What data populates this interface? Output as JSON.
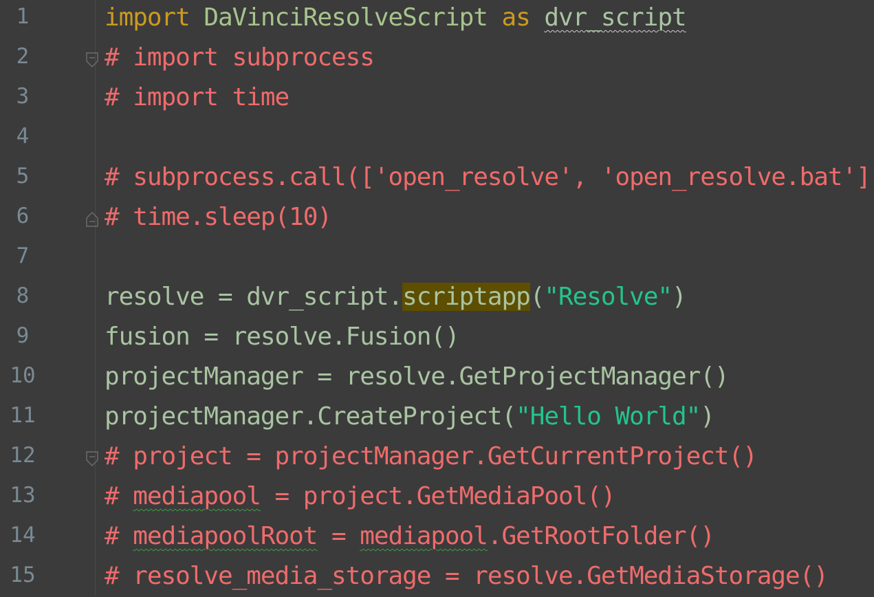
{
  "editor": {
    "lines": [
      {
        "n": "1",
        "tokens": [
          [
            "kw",
            "import"
          ],
          [
            "plain",
            " "
          ],
          [
            "mod",
            "DaVinciResolveScript"
          ],
          [
            "plain",
            " "
          ],
          [
            "kw",
            "as"
          ],
          [
            "plain",
            " "
          ],
          [
            "wavy",
            "dvr_script"
          ]
        ]
      },
      {
        "n": "2",
        "fold": "open",
        "tokens": [
          [
            "com",
            "# import subprocess"
          ]
        ]
      },
      {
        "n": "3",
        "tokens": [
          [
            "com",
            "# import time"
          ]
        ]
      },
      {
        "n": "4",
        "tokens": []
      },
      {
        "n": "5",
        "tokens": [
          [
            "com",
            "# subprocess.call(['open_resolve', 'open_resolve.bat'])"
          ]
        ]
      },
      {
        "n": "6",
        "fold": "close",
        "tokens": [
          [
            "com",
            "# time.sleep(10)"
          ]
        ]
      },
      {
        "n": "7",
        "tokens": []
      },
      {
        "n": "8",
        "tokens": [
          [
            "plain",
            "resolve = dvr_script."
          ],
          [
            "hl",
            "scriptapp"
          ],
          [
            "plain",
            "("
          ],
          [
            "str",
            "\"Resolve\""
          ],
          [
            "plain",
            ")"
          ]
        ]
      },
      {
        "n": "9",
        "tokens": [
          [
            "plain",
            "fusion = resolve.Fusion()"
          ]
        ]
      },
      {
        "n": "10",
        "tokens": [
          [
            "plain",
            "projectManager = resolve.GetProjectManager()"
          ]
        ]
      },
      {
        "n": "11",
        "tokens": [
          [
            "plain",
            "projectManager.CreateProject("
          ],
          [
            "str",
            "\"Hello World\""
          ],
          [
            "plain",
            ")"
          ]
        ]
      },
      {
        "n": "12",
        "fold": "open",
        "tokens": [
          [
            "com",
            "# project = projectManager.GetCurrentProject()"
          ]
        ]
      },
      {
        "n": "13",
        "tokens": [
          [
            "com",
            "# "
          ],
          [
            "comwavy",
            "mediapool"
          ],
          [
            "com",
            " = project.GetMediaPool()"
          ]
        ]
      },
      {
        "n": "14",
        "tokens": [
          [
            "com",
            "# "
          ],
          [
            "comwavy",
            "mediapoolRoot"
          ],
          [
            "com",
            " = "
          ],
          [
            "comwavy",
            "mediapool"
          ],
          [
            "com",
            ".GetRootFolder()"
          ]
        ]
      },
      {
        "n": "15",
        "tokens": [
          [
            "com",
            "# resolve_media_storage = resolve.GetMediaStorage()"
          ]
        ]
      }
    ]
  }
}
